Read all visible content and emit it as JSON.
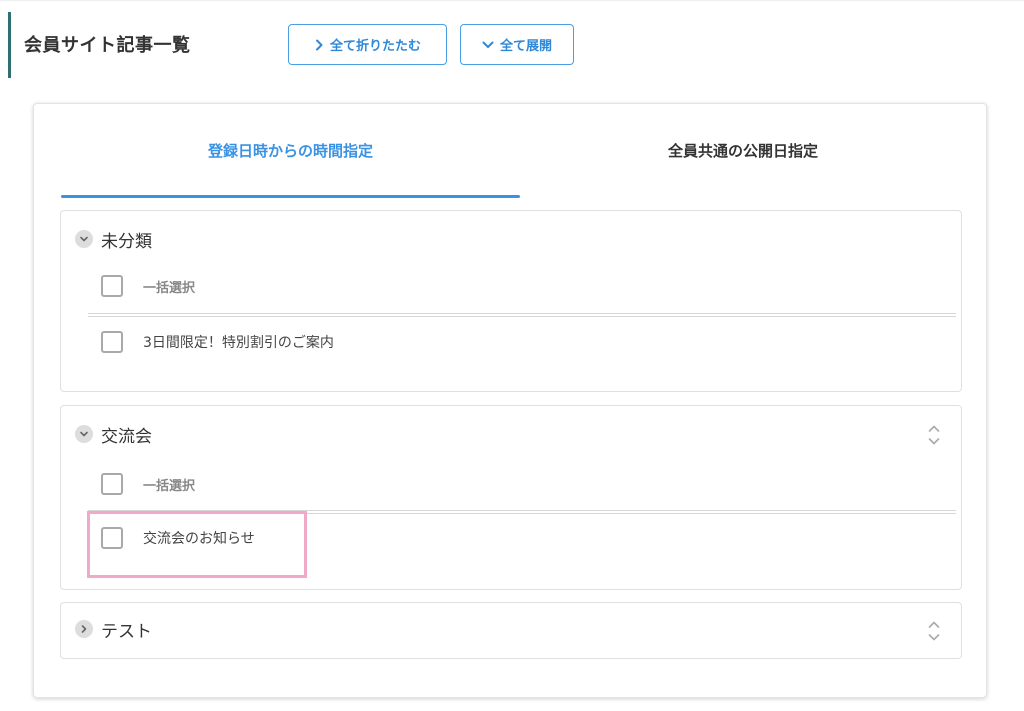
{
  "header": {
    "title": "会員サイト記事一覧",
    "collapse_all_label": "全て折りたたむ",
    "expand_all_label": "全て展開"
  },
  "tabs": [
    {
      "label": "登録日時からの時間指定",
      "active": true
    },
    {
      "label": "全員共通の公開日指定",
      "active": false
    }
  ],
  "categories": [
    {
      "name": "未分類",
      "expanded": true,
      "bulk_select_label": "一括選択",
      "articles": [
        "3日間限定！特別割引のご案内"
      ]
    },
    {
      "name": "交流会",
      "expanded": true,
      "bulk_select_label": "一括選択",
      "articles": [
        "交流会のお知らせ"
      ]
    },
    {
      "name": "テスト",
      "expanded": false
    }
  ],
  "colors": {
    "accent": "#3a92e4",
    "title_bar": "#2f6f73",
    "highlight": "#f2a8c8"
  }
}
